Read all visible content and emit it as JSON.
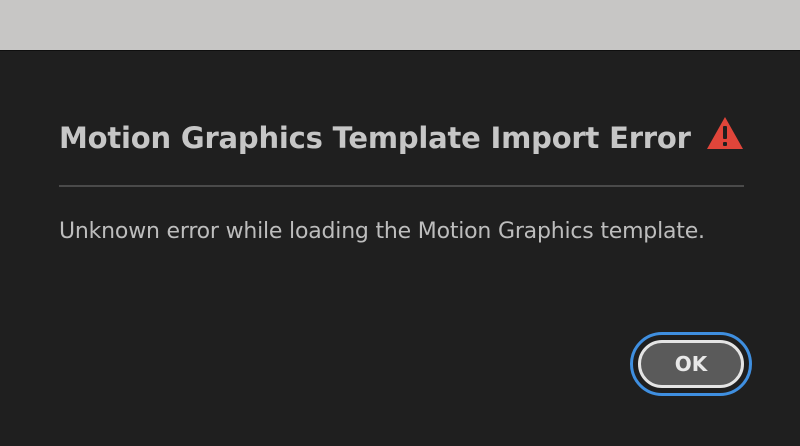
{
  "dialog": {
    "title": "Motion Graphics Template Import Error",
    "icon": "warning-icon",
    "message": "Unknown error while loading the Motion Graphics template.",
    "ok_label": "OK"
  },
  "colors": {
    "dialog_background": "#1f1f1f",
    "window_strip": "#c7c6c5",
    "warning": "#e0453a",
    "focus_ring": "#3f8fe0",
    "button_fill": "#5a5a5a"
  }
}
